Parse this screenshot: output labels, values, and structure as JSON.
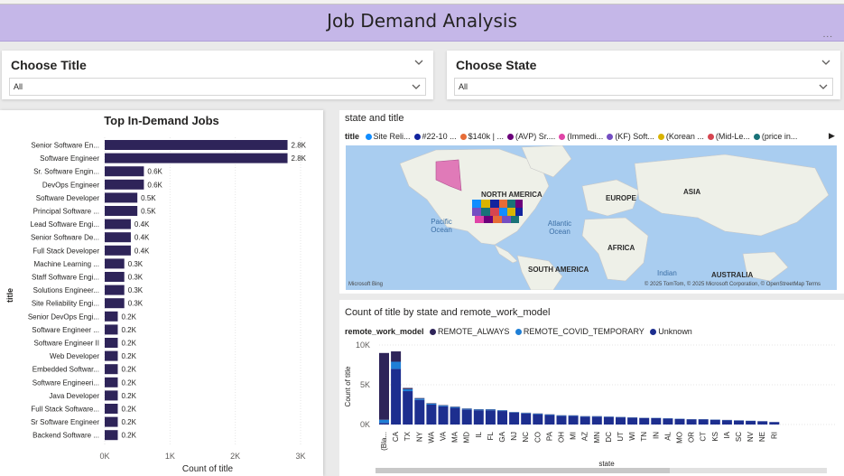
{
  "page": {
    "title": "Job Demand Analysis",
    "more_label": "..."
  },
  "colors": {
    "header_bg": "#c5b7e8",
    "bar": "#2e2459",
    "remote_always": "#2e2459",
    "remote_covid": "#1f7fd6",
    "unknown": "#1d2e8f"
  },
  "slicers": [
    {
      "header": "Choose Title",
      "value": "All"
    },
    {
      "header": "Choose State",
      "value": "All"
    }
  ],
  "bar_chart": {
    "title": "Top In-Demand Jobs"
  },
  "map": {
    "title": "state and title",
    "legend_key": "title",
    "legend": [
      {
        "label": "Site Reli...",
        "color": "#118dff"
      },
      {
        "label": "#22-10 ...",
        "color": "#12239e"
      },
      {
        "label": "$140k | ...",
        "color": "#e66c37"
      },
      {
        "label": "(AVP) Sr....",
        "color": "#6b007b"
      },
      {
        "label": "(Immedi...",
        "color": "#e044a7"
      },
      {
        "label": "(KF) Soft...",
        "color": "#744ec2"
      },
      {
        "label": "(Korean ...",
        "color": "#d9b300"
      },
      {
        "label": "(Mid-Le...",
        "color": "#d64550"
      },
      {
        "label": "(price in...",
        "color": "#197278"
      }
    ],
    "continents": [
      "NORTH AMERICA",
      "EUROPE",
      "ASIA",
      "AFRICA",
      "SOUTH AMERICA",
      "AUSTRALIA"
    ],
    "oceans": [
      "Pacific Ocean",
      "Atlantic Ocean",
      "Indian"
    ],
    "credit": "© 2025 TomTom, © 2025 Microsoft Corporation, © OpenStreetMap  Terms",
    "bing": "Microsoft Bing"
  },
  "stacked_chart": {
    "title": "Count of title by state and remote_work_model",
    "legend_key": "remote_work_model",
    "legend": [
      "REMOTE_ALWAYS",
      "REMOTE_COVID_TEMPORARY",
      "Unknown"
    ]
  },
  "chart_data": [
    {
      "type": "bar",
      "orientation": "horizontal",
      "title": "Top In-Demand Jobs",
      "xlabel": "Count of title",
      "ylabel": "title",
      "xlim": [
        0,
        3000
      ],
      "x_ticks": [
        "0K",
        "1K",
        "2K",
        "3K"
      ],
      "categories": [
        "Senior Software En...",
        "Software Engineer",
        "Sr. Software Engin...",
        "DevOps Engineer",
        "Software Developer",
        "Principal Software ...",
        "Lead Software Engi...",
        "Senior Software De...",
        "Full Stack Developer",
        "Machine Learning ...",
        "Staff Software Engi...",
        "Solutions Engineer...",
        "Site Reliability Engi...",
        "Senior DevOps Engi...",
        "Software Engineer ...",
        "Software Engineer II",
        "Web Developer",
        "Embedded Softwar...",
        "Software Engineeri...",
        "Java Developer",
        "Full Stack Software...",
        "Sr Software Engineer",
        "Backend Software ..."
      ],
      "values": [
        2800,
        2800,
        600,
        600,
        500,
        500,
        400,
        400,
        400,
        300,
        300,
        300,
        300,
        200,
        200,
        200,
        200,
        200,
        200,
        200,
        200,
        200,
        200
      ],
      "data_labels": [
        "2.8K",
        "2.8K",
        "0.6K",
        "0.6K",
        "0.5K",
        "0.5K",
        "0.4K",
        "0.4K",
        "0.4K",
        "0.3K",
        "0.3K",
        "0.3K",
        "0.3K",
        "0.2K",
        "0.2K",
        "0.2K",
        "0.2K",
        "0.2K",
        "0.2K",
        "0.2K",
        "0.2K",
        "0.2K",
        "0.2K"
      ],
      "grid": true
    },
    {
      "type": "bar",
      "stacked": true,
      "title": "Count of title by state and remote_work_model",
      "xlabel": "state",
      "ylabel": "Count of title",
      "ylim": [
        0,
        10000
      ],
      "y_ticks": [
        "0K",
        "5K",
        "10K"
      ],
      "categories": [
        "(Bla...",
        "CA",
        "TX",
        "NY",
        "WA",
        "VA",
        "MA",
        "MD",
        "IL",
        "FL",
        "GA",
        "NJ",
        "NC",
        "CO",
        "PA",
        "OH",
        "MI",
        "AZ",
        "MN",
        "DC",
        "UT",
        "WI",
        "TN",
        "IN",
        "AL",
        "MO",
        "OR",
        "CT",
        "KS",
        "IA",
        "SC",
        "NV",
        "NE",
        "RI"
      ],
      "series": [
        {
          "name": "REMOTE_ALWAYS",
          "values": [
            8400,
            1300,
            150,
            80,
            60,
            50,
            50,
            40,
            40,
            40,
            30,
            30,
            30,
            30,
            30,
            20,
            20,
            20,
            20,
            20,
            20,
            20,
            20,
            10,
            10,
            10,
            10,
            10,
            10,
            10,
            10,
            10,
            10,
            10
          ]
        },
        {
          "name": "REMOTE_COVID_TEMPORARY",
          "values": [
            400,
            900,
            250,
            150,
            120,
            100,
            100,
            80,
            80,
            80,
            70,
            60,
            60,
            60,
            50,
            50,
            40,
            40,
            40,
            40,
            40,
            30,
            30,
            30,
            30,
            30,
            20,
            20,
            20,
            20,
            20,
            20,
            10,
            10
          ]
        },
        {
          "name": "Unknown",
          "values": [
            200,
            7000,
            4200,
            3100,
            2500,
            2300,
            2100,
            1900,
            1800,
            1800,
            1700,
            1500,
            1400,
            1300,
            1200,
            1100,
            1100,
            1000,
            1000,
            950,
            900,
            850,
            800,
            800,
            750,
            700,
            650,
            650,
            600,
            550,
            500,
            450,
            400,
            300
          ]
        }
      ]
    }
  ]
}
